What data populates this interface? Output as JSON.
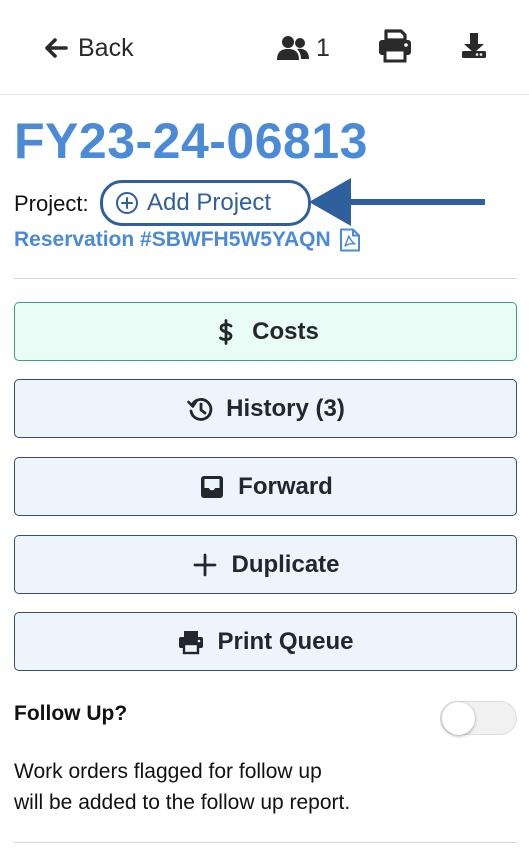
{
  "topbar": {
    "back_label": "Back",
    "users_count": "1",
    "icons": {
      "back": "arrow-left-icon",
      "users": "users-icon",
      "print": "printer-icon",
      "download": "download-icon"
    }
  },
  "work_order": {
    "id": "FY23-24-06813",
    "project_label": "Project:",
    "add_project_label": "Add Project",
    "reservation_label": "Reservation #SBWFH5W5YAQN"
  },
  "actions": [
    {
      "key": "costs",
      "label": "Costs",
      "icon": "dollar-icon"
    },
    {
      "key": "history",
      "label": "History (3)",
      "icon": "history-icon"
    },
    {
      "key": "forward",
      "label": "Forward",
      "icon": "inbox-icon"
    },
    {
      "key": "duplicate",
      "label": "Duplicate",
      "icon": "plus-icon"
    },
    {
      "key": "print_queue",
      "label": "Print Queue",
      "icon": "printer-icon"
    }
  ],
  "follow_up": {
    "label": "Follow Up?",
    "enabled": false,
    "description_line1": "Work orders flagged for follow up",
    "description_line2": "will be added to the follow up report."
  },
  "colors": {
    "accent_blue": "#4a8ad6",
    "annotation_blue": "#2f5f9c",
    "costs_bg": "#e9fcf6",
    "button_bg": "#eef4fc"
  }
}
